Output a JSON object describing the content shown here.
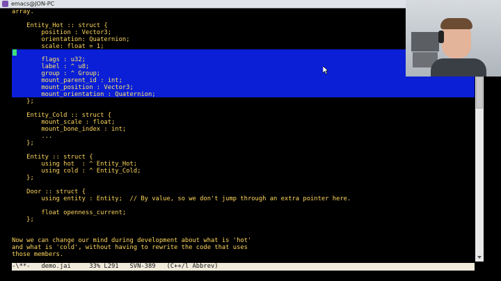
{
  "window": {
    "title": "emacs@JON-PC"
  },
  "editor": {
    "lines": [
      "array.",
      "",
      "    Entity_Hot :: struct {",
      "        position : Vector3;",
      "        orientation: Quaternion;",
      "        scale: float = 1;",
      "",
      "        flags : u32;",
      "        label : ^ u8;",
      "        group : ^ Group;",
      "        mount_parent_id : int;",
      "        mount_position : Vector3;",
      "        mount_orientation : Quaternion;",
      "    };",
      "",
      "    Entity_Cold :: struct {",
      "        mount_scale : float;",
      "        mount_bone_index : int;",
      "        ...",
      "    };",
      "",
      "    Entity :: struct {",
      "        using hot  : ^ Entity_Hot;",
      "        using cold : ^ Entity_Cold;",
      "    };",
      "",
      "    Door :: struct {",
      "        using entity : Entity;  // By value, so we don't jump through an extra pointer here.",
      "",
      "        float openness_current;",
      "    };",
      "",
      "",
      "Now we can change our mind during development about what is 'hot'",
      "and what is 'cold', without having to rewrite the code that uses",
      "those members."
    ]
  },
  "modeline": {
    "text": "-\\**-   demo.jai     33% L291   SVN-389   (C++/l Abbrev)"
  },
  "colors": {
    "code_text": "#ffd75e",
    "selection": "#0a1fd6",
    "cursor": "#3ee07a",
    "modeline_bg": "#f0eadb"
  }
}
